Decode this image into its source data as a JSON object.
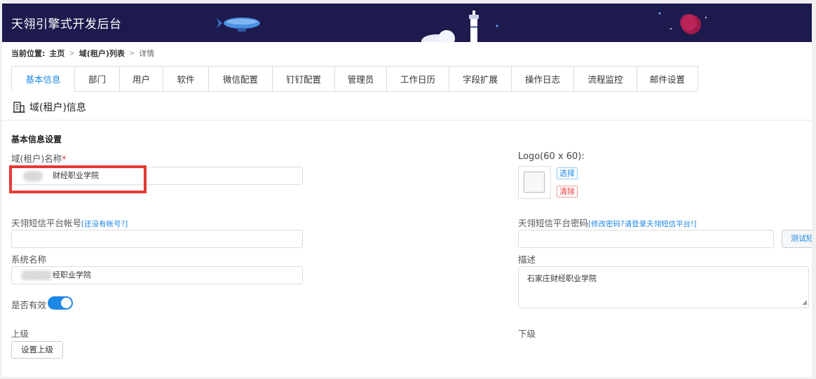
{
  "header": {
    "title": "天翎引擎式开发后台"
  },
  "breadcrumb": {
    "label": "当前位置:",
    "home": "主页",
    "list": "域(租户)列表",
    "current": "详情"
  },
  "tabs": [
    "基本信息",
    "部门",
    "用户",
    "软件",
    "微信配置",
    "钉钉配置",
    "管理员",
    "工作日历",
    "字段扩展",
    "操作日志",
    "流程监控",
    "邮件设置"
  ],
  "section": {
    "title": "域(租户)信息",
    "subtitle": "基本信息设置"
  },
  "form": {
    "domain_name_label": "域(租户)名称",
    "domain_name_required": "*",
    "domain_name_value": "财经职业学院",
    "logo_label": "Logo(60 x 60):",
    "logo_choose": "选择",
    "logo_clear": "清除",
    "sms_account_label": "天翎短信平台帐号",
    "sms_account_link": "[还没有帐号?]",
    "sms_account_value": "",
    "sms_password_label": "天翎短信平台密码",
    "sms_password_link": "[修改密码?请登录天翎短信平台!]",
    "sms_password_value": "",
    "test_button": "测试短信",
    "system_name_label": "系统名称",
    "system_name_value": "经职业学院",
    "desc_label": "描述",
    "desc_value": "石家庄财经职业学院",
    "active_label": "是否有效",
    "active_on": true,
    "parent_label": "上级",
    "child_label": "下级",
    "set_parent_button": "设置上级"
  },
  "colors": {
    "header_bg": "#1d1a4e",
    "accent": "#1e88e5",
    "highlight": "#e53935"
  }
}
